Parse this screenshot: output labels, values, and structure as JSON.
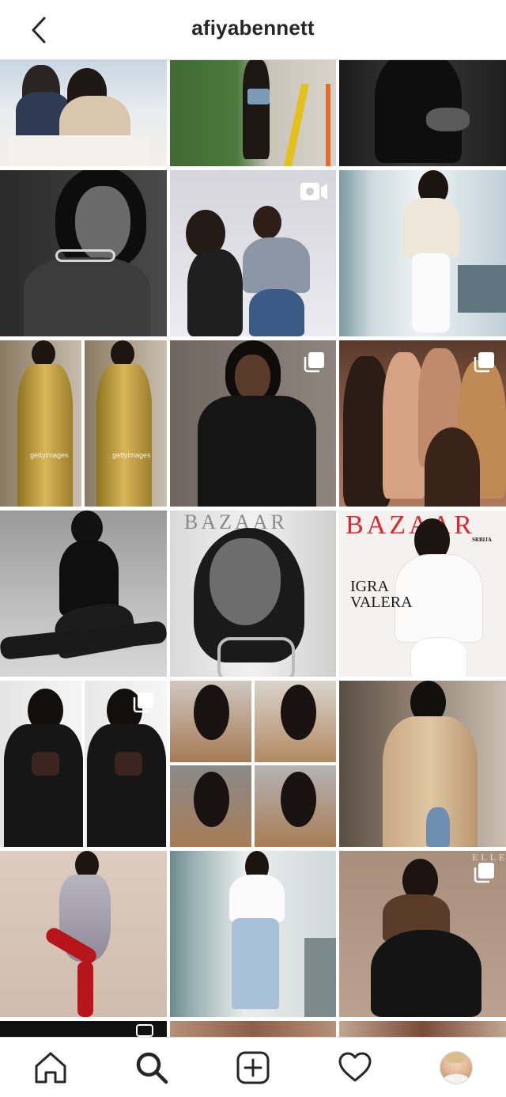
{
  "header": {
    "username": "afiyabennett",
    "back_icon": "chevron-left-icon"
  },
  "grid": {
    "tiles": [
      {
        "type": "photo"
      },
      {
        "type": "photo"
      },
      {
        "type": "photo"
      },
      {
        "type": "photo"
      },
      {
        "type": "video",
        "badge_icon": "video-camera-icon"
      },
      {
        "type": "photo"
      },
      {
        "type": "photo",
        "watermark_left": "gettyimages",
        "watermark_right": "gettyimages"
      },
      {
        "type": "carousel",
        "badge_icon": "carousel-icon"
      },
      {
        "type": "carousel",
        "badge_icon": "carousel-icon"
      },
      {
        "type": "photo"
      },
      {
        "type": "photo",
        "masthead": "BAZAAR"
      },
      {
        "type": "photo",
        "masthead": "BAZAAR",
        "edition": "SRBIJA",
        "cover_line_1": "IGRA",
        "cover_line_2": "VALERA"
      },
      {
        "type": "carousel",
        "badge_icon": "carousel-icon"
      },
      {
        "type": "photo"
      },
      {
        "type": "photo"
      },
      {
        "type": "photo"
      },
      {
        "type": "photo"
      },
      {
        "type": "carousel",
        "badge_icon": "carousel-icon",
        "masthead": "ELLE"
      }
    ]
  },
  "tabbar": {
    "items": [
      {
        "icon": "home-icon"
      },
      {
        "icon": "search-icon",
        "active": true
      },
      {
        "icon": "new-post-icon"
      },
      {
        "icon": "heart-icon"
      },
      {
        "icon": "profile-avatar"
      }
    ]
  },
  "colors": {
    "text": "#262626",
    "divider": "#dbdbdb",
    "background": "#ffffff"
  }
}
